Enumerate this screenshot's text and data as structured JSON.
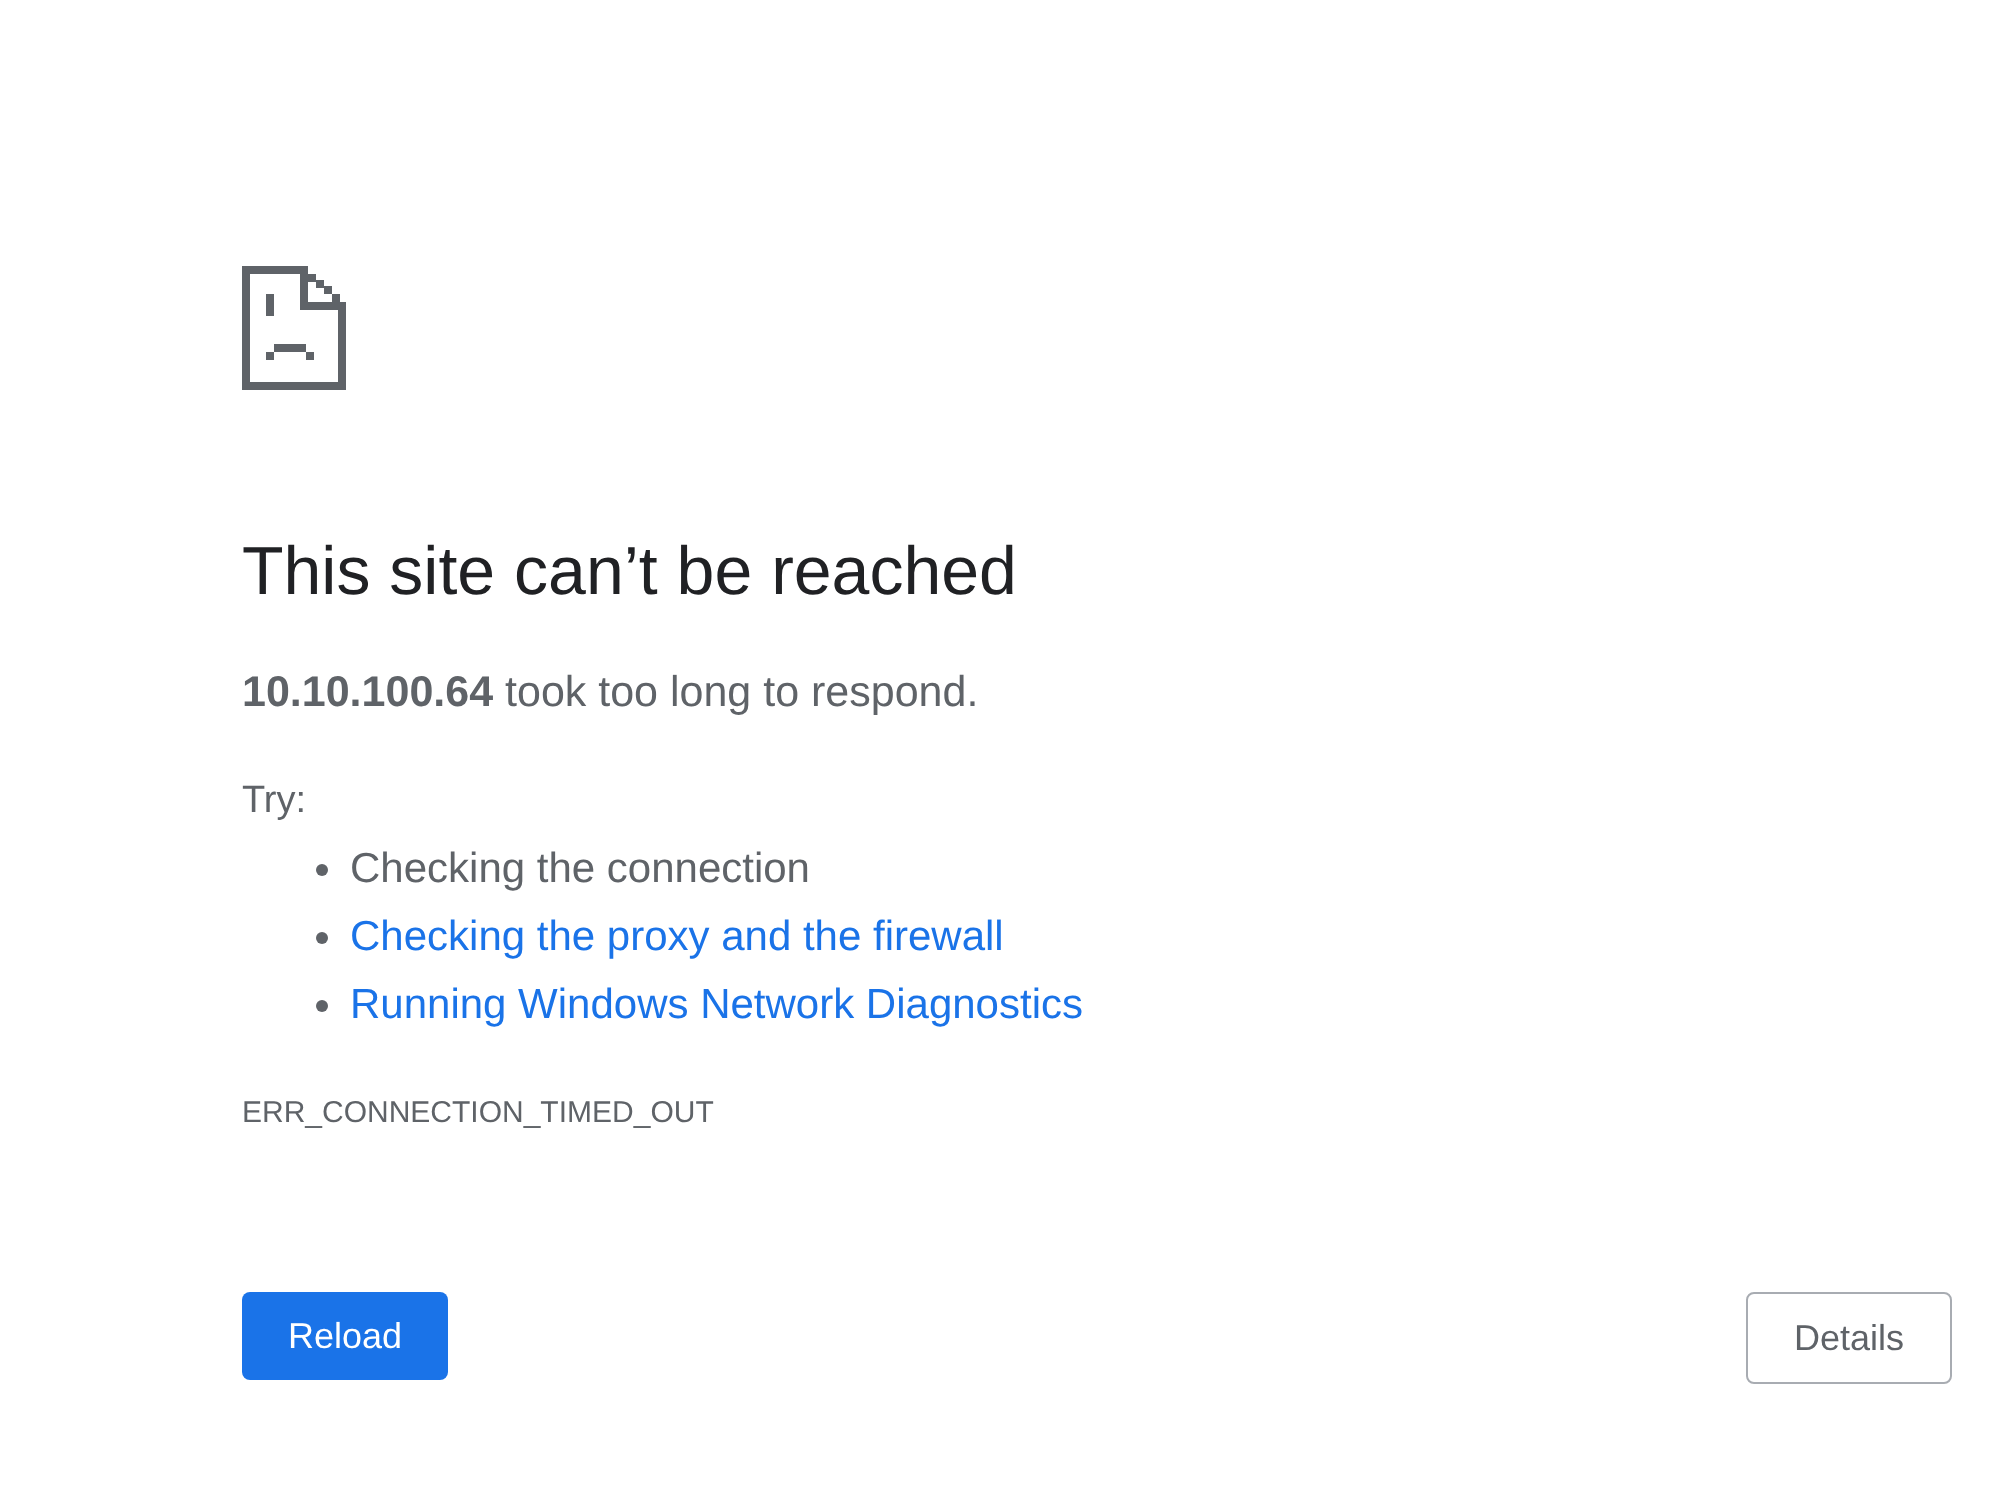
{
  "heading": "This site can’t be reached",
  "message": "**10.10.100.64** took too long to respond.",
  "suggestions": {
    "label": "Try:",
    "items": [
      {
        "kind": "text",
        "text": "Checking the connection"
      },
      {
        "kind": "link",
        "text": "Checking the proxy and the firewall"
      },
      {
        "kind": "link",
        "text": "Running Windows Network Diagnostics"
      }
    ]
  },
  "error_code": "ERR_CONNECTION_TIMED_OUT",
  "buttons": [
    {
      "kind": "primary",
      "label": "Reload"
    },
    {
      "kind": "secondary",
      "label": "Details"
    }
  ]
}
